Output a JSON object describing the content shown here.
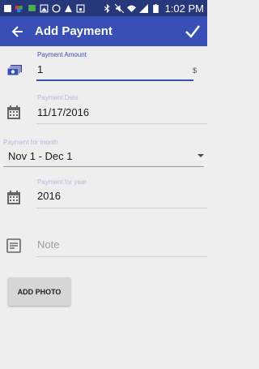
{
  "status_bar": {
    "time": "1:02 PM",
    "left_icons": [
      "notification-icon",
      "image-icon",
      "chat-icon",
      "image-icon",
      "whatsapp-icon",
      "warning-icon",
      "music-icon"
    ],
    "right_icons": [
      "bluetooth-icon",
      "mute-icon",
      "wifi-icon",
      "signal-icon",
      "battery-icon"
    ]
  },
  "app_bar": {
    "title": "Add Payment",
    "back_icon": "arrow-back-icon",
    "confirm_icon": "check-icon"
  },
  "form": {
    "amount": {
      "label": "Payment Amount",
      "value": "1",
      "suffix": "$",
      "icon": "money-icon"
    },
    "date": {
      "label": "Payment Date",
      "value": "11/17/2016",
      "icon": "calendar-icon"
    },
    "month": {
      "label": "Payment for month",
      "value": "Nov 1 - Dec 1"
    },
    "year": {
      "label": "Payment for year",
      "value": "2016",
      "icon": "calendar-icon"
    },
    "note": {
      "placeholder": "Note",
      "icon": "note-icon"
    }
  },
  "add_photo_label": "ADD PHOTO",
  "colors": {
    "status_bar": "#27387a",
    "app_bar": "#3850b5",
    "accent": "#3850b5",
    "background": "#eeeeee"
  }
}
